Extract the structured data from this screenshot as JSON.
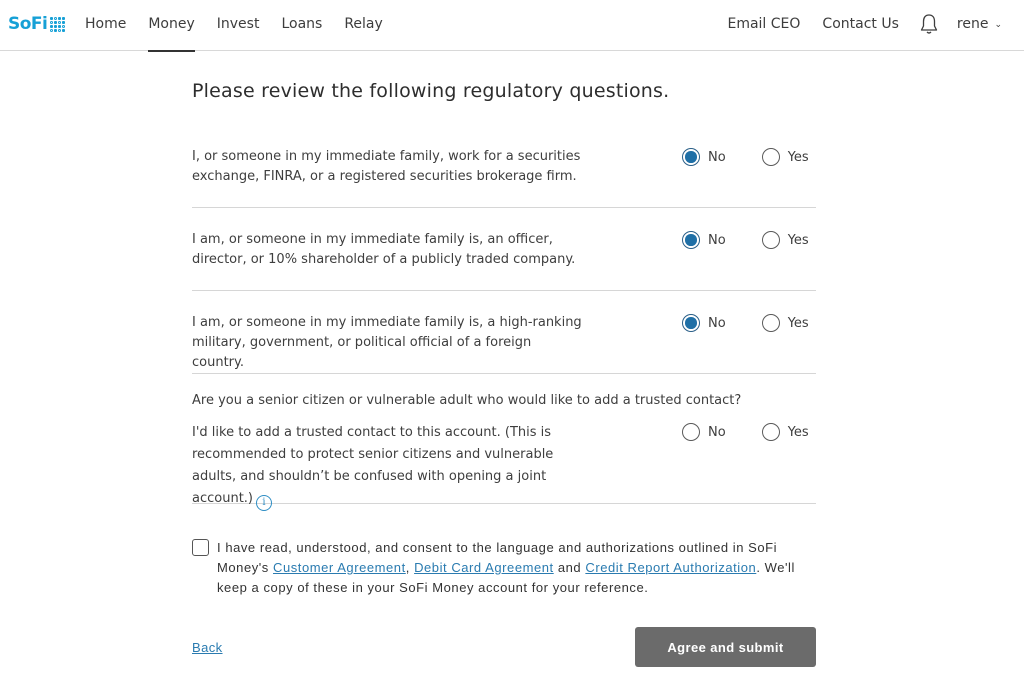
{
  "nav": {
    "logo_text": "SoFi",
    "brand_color": "#16a0d6",
    "left_items": [
      {
        "label": "Home",
        "active": false
      },
      {
        "label": "Money",
        "active": true
      },
      {
        "label": "Invest",
        "active": false
      },
      {
        "label": "Loans",
        "active": false
      },
      {
        "label": "Relay",
        "active": false
      }
    ],
    "right_items": [
      {
        "label": "Email CEO"
      },
      {
        "label": "Contact Us"
      }
    ],
    "notifications_icon": "bell-icon",
    "user": {
      "name": "rene",
      "chevron": "chevron-down-icon"
    }
  },
  "page": {
    "title": "Please review the following regulatory questions.",
    "questions": [
      {
        "text": "I, or someone in my immediate family, work for a securities exchange, FINRA, or a registered securities brokerage firm.",
        "options": [
          "No",
          "Yes"
        ],
        "selected": "No"
      },
      {
        "text": "I am, or someone in my immediate family is, an officer, director, or 10% shareholder of a publicly traded company.",
        "options": [
          "No",
          "Yes"
        ],
        "selected": "No"
      },
      {
        "text": "I am, or someone in my immediate family is, a high-ranking military, government, or political official of a foreign country.",
        "options": [
          "No",
          "Yes"
        ],
        "selected": "No"
      },
      {
        "heading": "Are you a senior citizen or vulnerable adult who would like to add a trusted contact?",
        "text": "I'd like to add a trusted contact to this account. (This is recommended to protect senior citizens and vulnerable adults, and shouldn’t be confused with opening a joint account.)",
        "info_icon": "info-icon",
        "options": [
          "No",
          "Yes"
        ],
        "selected": null
      }
    ],
    "consent": {
      "checked": false,
      "text_before": "I have read, understood, and consent to the language and authorizations outlined in SoFi Money's ",
      "link1": "Customer Agreement",
      "sep1": ", ",
      "link2": "Debit Card Agreement",
      "sep2": " and ",
      "link3": "Credit Report Authorization",
      "text_after": ". We'll keep a copy of these in your SoFi Money account for your reference."
    },
    "back_label": "Back",
    "submit_label": "Agree and submit",
    "accent_color": "#1f6fa6",
    "link_color": "#2a7bb0",
    "submit_color": "#6b6b6b"
  }
}
